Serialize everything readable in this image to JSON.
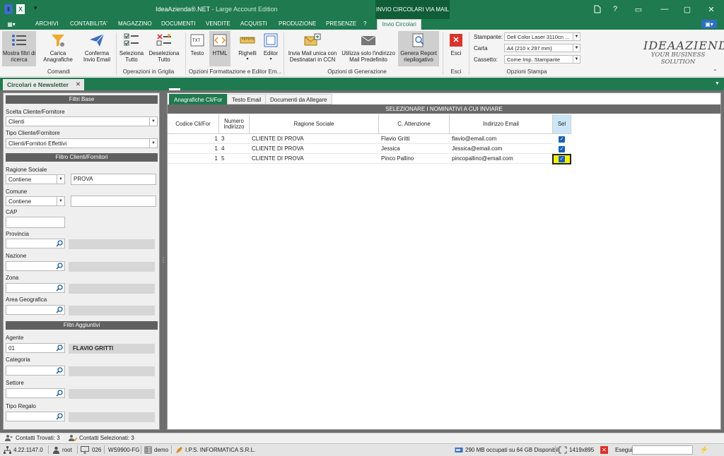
{
  "window": {
    "app_name": "IdeaAzienda®.NET",
    "app_edition": " - Large Account Edition",
    "context_title": "INVIO CIRCOLARI VIA MAIL",
    "controls": [
      "?",
      "▭",
      "—",
      "▢",
      "✕"
    ]
  },
  "menu": {
    "items": [
      "ARCHIVI",
      "CONTABILITA'",
      "MAGAZZINO",
      "DOCUMENTI",
      "VENDITE",
      "ACQUISTI",
      "PRODUZIONE",
      "PRESENZE",
      "?"
    ],
    "active_tab": "Invio Circolari"
  },
  "ribbon": {
    "buttons": {
      "mostra_filtri": "Mostra filtri di ricerca",
      "carica_anagrafiche": "Carica Anagrafiche",
      "conferma_invio": "Conferma Invio Email",
      "seleziona_tutto": "Seleziona Tutto",
      "deseleziona_tutto": "Deseleziona Tutto",
      "testo": "Testo",
      "html": "HTML",
      "righelli": "Righelli",
      "editor": "Editor",
      "invia_mail_unica": "Invia Mail unica con Destinatari in CCN",
      "utilizza_indirizzo": "Utilizza solo l'indirizzo Mail Predefinito",
      "genera_report": "Genera Report riepilogativo",
      "esci": "Esci"
    },
    "groups": {
      "comandi": "Comandi",
      "operazioni_griglia": "Operazioni in Griglia",
      "opzioni_formattazione": "Opzioni Formattazione e Editor Em...",
      "opzioni_generazione": "Opzioni di Generazione",
      "esci": "Esci",
      "opzioni_stampa": "Opzioni Stampa"
    },
    "print": {
      "stampante_label": "Stampante:",
      "stampante_value": "Dell Color Laser 3110cn ...",
      "carta_label": "Carta",
      "carta_value": "A4 (210 x 297 mm)",
      "cassetto_label": "Cassetto:",
      "cassetto_value": "Come Imp. Stampante"
    },
    "brand_line1": "IDEAAZIENDA",
    "brand_line2": "YOUR BUSINESS SOLUTION"
  },
  "doc_tab": {
    "label": "Circolari e Newsletter",
    "close": "✕"
  },
  "filters": {
    "filtri_base": "Filtri Base",
    "scelta_label": "Scelta Cliente/Fornitore",
    "scelta_value": "Clienti",
    "tipo_label": "Tipo Cliente/Fornitore",
    "tipo_value": "Clienti/Fornitori Effettivi",
    "filtro_clienti": "Filtro Clienti/Fornitori",
    "ragione_label": "Ragione Sociale",
    "ragione_op": "Contiene",
    "ragione_value": "PROVA",
    "comune_label": "Comune",
    "comune_op": "Contiene",
    "comune_value": "",
    "cap_label": "CAP",
    "provincia_label": "Provincia",
    "nazione_label": "Nazione",
    "zona_label": "Zona",
    "area_label": "Area Geografica",
    "filtri_aggiuntivi": "Filtri Aggiuntivi",
    "agente_label": "Agente",
    "agente_code": "01",
    "agente_name": "FLAVIO GRITTI",
    "categoria_label": "Categoria",
    "settore_label": "Settore",
    "tipo_regalo_label": "Tipo Regalo"
  },
  "tabs": [
    "Anagrafiche Cli/For",
    "Testo Email",
    "Documenti da Allegare"
  ],
  "grid": {
    "caption": "SELEZIONARE I NOMINATIVI A CUI INVIARE",
    "headers": {
      "codice": "Codice Cli/For",
      "numero": "Numero Indirizzo",
      "ragione": "Ragione Sociale",
      "attenzione": "C. Attenzione",
      "email": "Indirizzo Email",
      "sel": "Sel"
    },
    "rows": [
      {
        "codice": "1",
        "numero": "3",
        "ragione": "CLIENTE DI PROVA",
        "attenzione": "Flavio Gritti",
        "email": "flavio@email.com",
        "sel": true
      },
      {
        "codice": "1",
        "numero": "4",
        "ragione": "CLIENTE DI PROVA",
        "attenzione": "Jessica",
        "email": "Jessica@email.com",
        "sel": true
      },
      {
        "codice": "1",
        "numero": "5",
        "ragione": "CLIENTE DI PROVA",
        "attenzione": "Pinco Pallino",
        "email": "pincopallino@email.com",
        "sel": true
      }
    ]
  },
  "status": {
    "trovati": "Contatti Trovati: 3",
    "selezionati": "Contatti Selezionati: 3",
    "version": "4.22.1147.0",
    "user": "root",
    "terminal": "026",
    "workstation": "WS9900-FG",
    "db": "demo",
    "company": "I.P.S. INFORMATICA S.R.L.",
    "disk": "290 MB occupati su 64 GB Disponibili",
    "resolution": "1419x895",
    "esegui": "Esegui"
  }
}
